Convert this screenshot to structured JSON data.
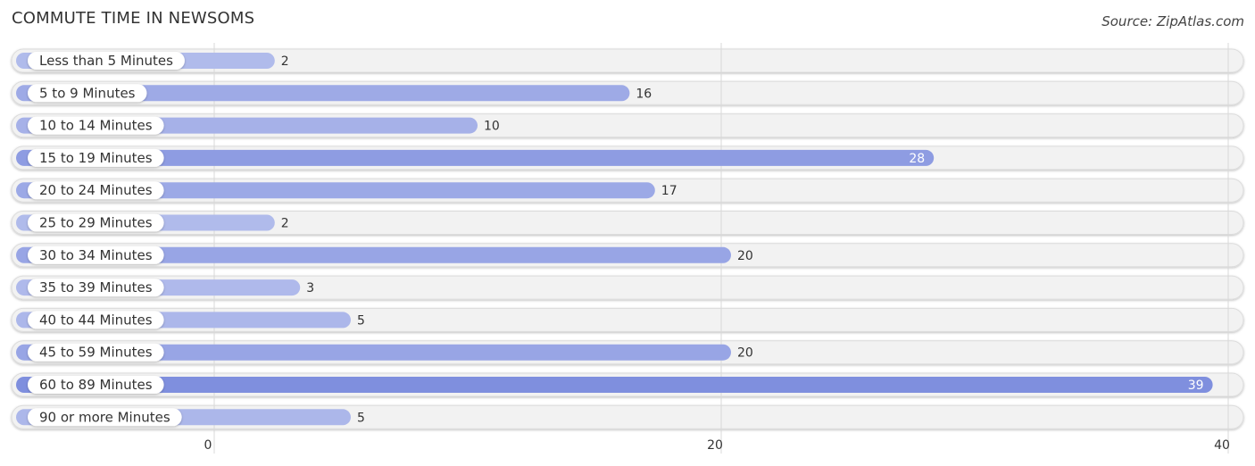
{
  "chart_data": {
    "type": "bar",
    "orientation": "horizontal",
    "title": "COMMUTE TIME IN NEWSOMS",
    "source": "Source: ZipAtlas.com",
    "categories": [
      "Less than 5 Minutes",
      "5 to 9 Minutes",
      "10 to 14 Minutes",
      "15 to 19 Minutes",
      "20 to 24 Minutes",
      "25 to 29 Minutes",
      "30 to 34 Minutes",
      "35 to 39 Minutes",
      "40 to 44 Minutes",
      "45 to 59 Minutes",
      "60 to 89 Minutes",
      "90 or more Minutes"
    ],
    "values": [
      2,
      16,
      10,
      28,
      17,
      2,
      20,
      3,
      5,
      20,
      39,
      5
    ],
    "xticks": [
      0,
      20,
      40
    ],
    "xlim": [
      0,
      40
    ],
    "grid": true,
    "colors": {
      "low": "#b3bdec",
      "high": "#7f8fde",
      "track": "#f2f2f2"
    }
  }
}
